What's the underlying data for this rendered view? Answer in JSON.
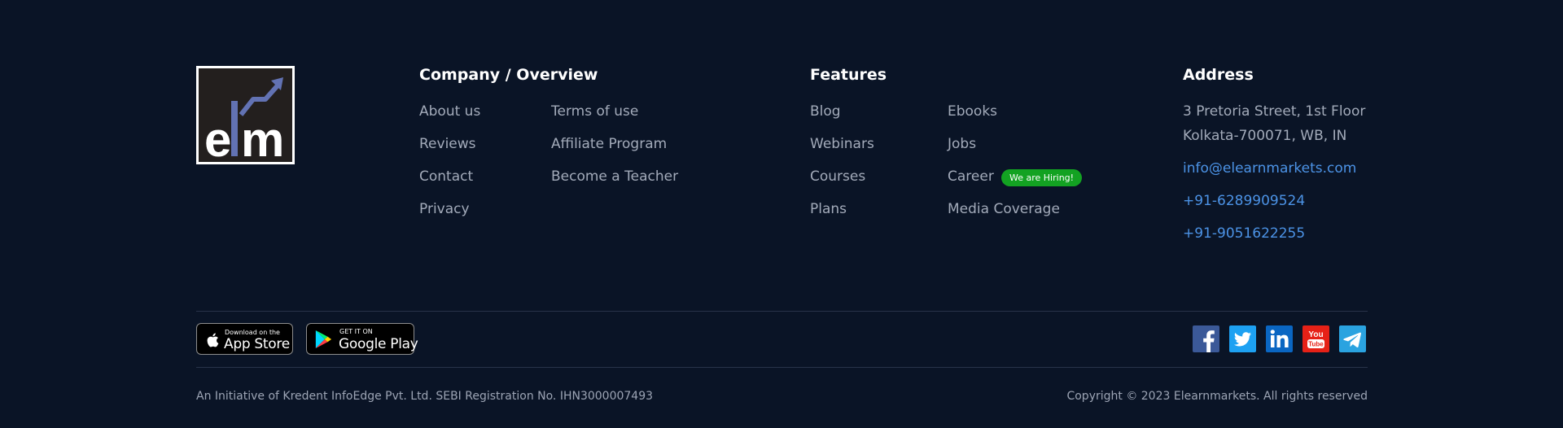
{
  "company": {
    "title": "Company / Overview",
    "left_links": [
      "About us",
      "Reviews",
      "Contact",
      "Privacy"
    ],
    "right_links": [
      "Terms of use",
      "Affiliate Program",
      "Become a Teacher"
    ]
  },
  "features": {
    "title": "Features",
    "left_links": [
      "Blog",
      "Webinars",
      "Courses",
      "Plans"
    ],
    "right_links": [
      "Ebooks",
      "Jobs",
      "Career",
      "Media Coverage"
    ],
    "career_badge": "We are Hiring!"
  },
  "address": {
    "title": "Address",
    "line1": "3 Pretoria Street, 1st Floor",
    "line2": "Kolkata-700071, WB, IN",
    "email": "info@elearnmarkets.com",
    "phone1": "+91-6289909524",
    "phone2": "+91-9051622255"
  },
  "stores": {
    "apple_small": "Download on the",
    "apple_big": "App Store",
    "google_small": "GET IT ON",
    "google_big": "Google Play"
  },
  "social_icons": [
    "facebook-icon",
    "twitter-icon",
    "linkedin-icon",
    "youtube-icon",
    "telegram-icon"
  ],
  "bottom": {
    "left": "An Initiative of Kredent InfoEdge Pvt. Ltd. SEBI Registration No. IHN3000007493",
    "right": "Copyright © 2023 Elearnmarkets. All rights reserved"
  },
  "colors": {
    "background": "#0a1426",
    "link_blue": "#4c93e6",
    "badge_green": "#13a222",
    "facebook": "#3b5998",
    "twitter": "#1da1f2",
    "linkedin": "#0a66c2",
    "youtube": "#e62117",
    "telegram": "#2aa3e0"
  }
}
